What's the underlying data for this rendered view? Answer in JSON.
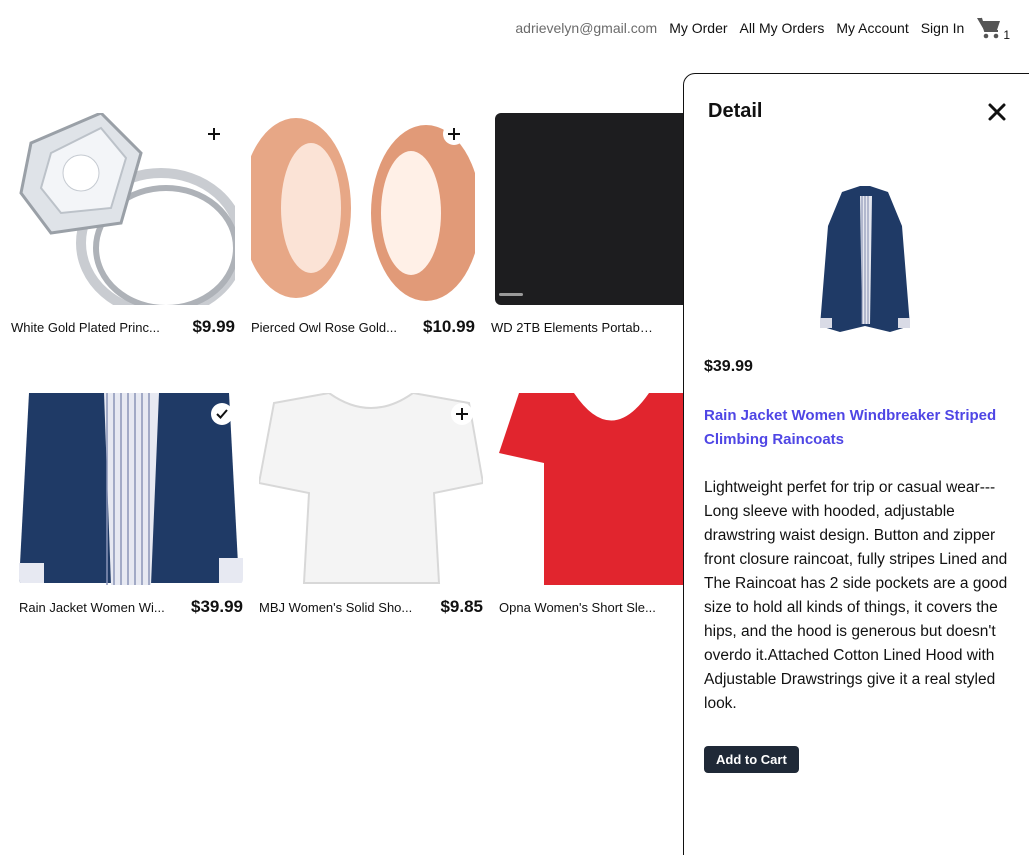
{
  "navbar": {
    "email": "adrievelyn@gmail.com",
    "my_order": "My Order",
    "all_my_orders": "All My Orders",
    "my_account": "My Account",
    "sign_in": "Sign In",
    "cart_icon": "shopping-cart-icon",
    "cart_count": "1"
  },
  "products": [
    {
      "title": "White Gold Plated Princ...",
      "price": "$9.99",
      "action": "plus"
    },
    {
      "title": "Pierced Owl Rose Gold...",
      "price": "$10.99",
      "action": "plus"
    },
    {
      "title": "WD 2TB Elements Portabl...",
      "price": "$",
      "action": "plus"
    },
    {
      "title": "Rain Jacket Women Wi...",
      "price": "$39.99",
      "action": "check"
    },
    {
      "title": "MBJ Women's Solid Sho...",
      "price": "$9.85",
      "action": "plus"
    },
    {
      "title": "Opna Women's Short Sle...",
      "price": "$",
      "action": "plus"
    }
  ],
  "detail": {
    "heading": "Detail",
    "close_icon": "close-icon",
    "price": "$39.99",
    "title": "Rain Jacket Women Windbreaker Striped Climbing Raincoats",
    "description": "Lightweight perfet for trip or casual wear---Long sleeve with hooded, adjustable drawstring waist design. Button and zipper front closure raincoat, fully stripes Lined and The Raincoat has 2 side pockets are a good size to hold all kinds of things, it covers the hips, and the hood is generous but doesn't overdo it.Attached Cotton Lined Hood with Adjustable Drawstrings give it a real styled look.",
    "add_to_cart": "Add to Cart"
  },
  "colors": {
    "accent_link": "#4f46e5",
    "button_dark": "#1f2937"
  }
}
